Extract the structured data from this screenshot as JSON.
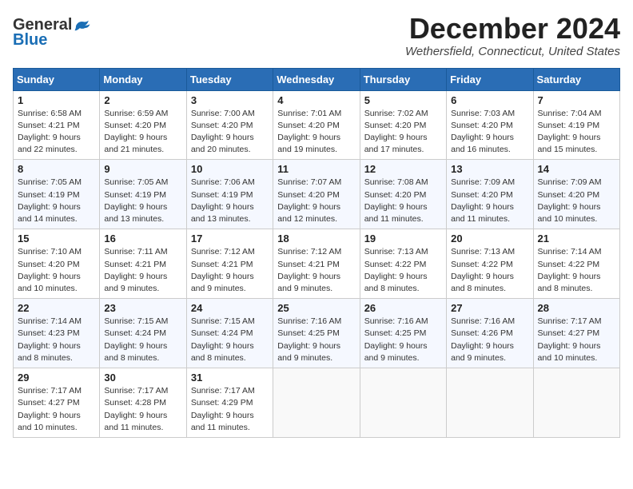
{
  "logo": {
    "general": "General",
    "blue": "Blue"
  },
  "title": "December 2024",
  "location": "Wethersfield, Connecticut, United States",
  "days_header": [
    "Sunday",
    "Monday",
    "Tuesday",
    "Wednesday",
    "Thursday",
    "Friday",
    "Saturday"
  ],
  "weeks": [
    [
      {
        "day": "1",
        "sunrise": "Sunrise: 6:58 AM",
        "sunset": "Sunset: 4:21 PM",
        "daylight": "Daylight: 9 hours and 22 minutes."
      },
      {
        "day": "2",
        "sunrise": "Sunrise: 6:59 AM",
        "sunset": "Sunset: 4:20 PM",
        "daylight": "Daylight: 9 hours and 21 minutes."
      },
      {
        "day": "3",
        "sunrise": "Sunrise: 7:00 AM",
        "sunset": "Sunset: 4:20 PM",
        "daylight": "Daylight: 9 hours and 20 minutes."
      },
      {
        "day": "4",
        "sunrise": "Sunrise: 7:01 AM",
        "sunset": "Sunset: 4:20 PM",
        "daylight": "Daylight: 9 hours and 19 minutes."
      },
      {
        "day": "5",
        "sunrise": "Sunrise: 7:02 AM",
        "sunset": "Sunset: 4:20 PM",
        "daylight": "Daylight: 9 hours and 17 minutes."
      },
      {
        "day": "6",
        "sunrise": "Sunrise: 7:03 AM",
        "sunset": "Sunset: 4:20 PM",
        "daylight": "Daylight: 9 hours and 16 minutes."
      },
      {
        "day": "7",
        "sunrise": "Sunrise: 7:04 AM",
        "sunset": "Sunset: 4:19 PM",
        "daylight": "Daylight: 9 hours and 15 minutes."
      }
    ],
    [
      {
        "day": "8",
        "sunrise": "Sunrise: 7:05 AM",
        "sunset": "Sunset: 4:19 PM",
        "daylight": "Daylight: 9 hours and 14 minutes."
      },
      {
        "day": "9",
        "sunrise": "Sunrise: 7:05 AM",
        "sunset": "Sunset: 4:19 PM",
        "daylight": "Daylight: 9 hours and 13 minutes."
      },
      {
        "day": "10",
        "sunrise": "Sunrise: 7:06 AM",
        "sunset": "Sunset: 4:19 PM",
        "daylight": "Daylight: 9 hours and 13 minutes."
      },
      {
        "day": "11",
        "sunrise": "Sunrise: 7:07 AM",
        "sunset": "Sunset: 4:20 PM",
        "daylight": "Daylight: 9 hours and 12 minutes."
      },
      {
        "day": "12",
        "sunrise": "Sunrise: 7:08 AM",
        "sunset": "Sunset: 4:20 PM",
        "daylight": "Daylight: 9 hours and 11 minutes."
      },
      {
        "day": "13",
        "sunrise": "Sunrise: 7:09 AM",
        "sunset": "Sunset: 4:20 PM",
        "daylight": "Daylight: 9 hours and 11 minutes."
      },
      {
        "day": "14",
        "sunrise": "Sunrise: 7:09 AM",
        "sunset": "Sunset: 4:20 PM",
        "daylight": "Daylight: 9 hours and 10 minutes."
      }
    ],
    [
      {
        "day": "15",
        "sunrise": "Sunrise: 7:10 AM",
        "sunset": "Sunset: 4:20 PM",
        "daylight": "Daylight: 9 hours and 10 minutes."
      },
      {
        "day": "16",
        "sunrise": "Sunrise: 7:11 AM",
        "sunset": "Sunset: 4:21 PM",
        "daylight": "Daylight: 9 hours and 9 minutes."
      },
      {
        "day": "17",
        "sunrise": "Sunrise: 7:12 AM",
        "sunset": "Sunset: 4:21 PM",
        "daylight": "Daylight: 9 hours and 9 minutes."
      },
      {
        "day": "18",
        "sunrise": "Sunrise: 7:12 AM",
        "sunset": "Sunset: 4:21 PM",
        "daylight": "Daylight: 9 hours and 9 minutes."
      },
      {
        "day": "19",
        "sunrise": "Sunrise: 7:13 AM",
        "sunset": "Sunset: 4:22 PM",
        "daylight": "Daylight: 9 hours and 8 minutes."
      },
      {
        "day": "20",
        "sunrise": "Sunrise: 7:13 AM",
        "sunset": "Sunset: 4:22 PM",
        "daylight": "Daylight: 9 hours and 8 minutes."
      },
      {
        "day": "21",
        "sunrise": "Sunrise: 7:14 AM",
        "sunset": "Sunset: 4:22 PM",
        "daylight": "Daylight: 9 hours and 8 minutes."
      }
    ],
    [
      {
        "day": "22",
        "sunrise": "Sunrise: 7:14 AM",
        "sunset": "Sunset: 4:23 PM",
        "daylight": "Daylight: 9 hours and 8 minutes."
      },
      {
        "day": "23",
        "sunrise": "Sunrise: 7:15 AM",
        "sunset": "Sunset: 4:24 PM",
        "daylight": "Daylight: 9 hours and 8 minutes."
      },
      {
        "day": "24",
        "sunrise": "Sunrise: 7:15 AM",
        "sunset": "Sunset: 4:24 PM",
        "daylight": "Daylight: 9 hours and 8 minutes."
      },
      {
        "day": "25",
        "sunrise": "Sunrise: 7:16 AM",
        "sunset": "Sunset: 4:25 PM",
        "daylight": "Daylight: 9 hours and 9 minutes."
      },
      {
        "day": "26",
        "sunrise": "Sunrise: 7:16 AM",
        "sunset": "Sunset: 4:25 PM",
        "daylight": "Daylight: 9 hours and 9 minutes."
      },
      {
        "day": "27",
        "sunrise": "Sunrise: 7:16 AM",
        "sunset": "Sunset: 4:26 PM",
        "daylight": "Daylight: 9 hours and 9 minutes."
      },
      {
        "day": "28",
        "sunrise": "Sunrise: 7:17 AM",
        "sunset": "Sunset: 4:27 PM",
        "daylight": "Daylight: 9 hours and 10 minutes."
      }
    ],
    [
      {
        "day": "29",
        "sunrise": "Sunrise: 7:17 AM",
        "sunset": "Sunset: 4:27 PM",
        "daylight": "Daylight: 9 hours and 10 minutes."
      },
      {
        "day": "30",
        "sunrise": "Sunrise: 7:17 AM",
        "sunset": "Sunset: 4:28 PM",
        "daylight": "Daylight: 9 hours and 11 minutes."
      },
      {
        "day": "31",
        "sunrise": "Sunrise: 7:17 AM",
        "sunset": "Sunset: 4:29 PM",
        "daylight": "Daylight: 9 hours and 11 minutes."
      },
      null,
      null,
      null,
      null
    ]
  ]
}
